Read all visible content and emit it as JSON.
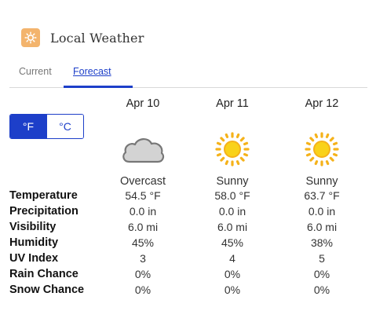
{
  "header": {
    "title": "Local Weather",
    "icon": "weather-app-icon",
    "icon_color": "#f3b46d"
  },
  "tabs": [
    {
      "label": "Current",
      "active": false
    },
    {
      "label": "Forecast",
      "active": true
    }
  ],
  "units": {
    "fahrenheit": "°F",
    "celsius": "°C",
    "selected": "°F"
  },
  "accent_color": "#1d3fc9",
  "rows": [
    "Temperature",
    "Precipitation",
    "Visibility",
    "Humidity",
    "UV Index",
    "Rain Chance",
    "Snow Chance"
  ],
  "days": [
    {
      "date": "Apr 10",
      "icon": "cloud-icon",
      "condition": "Overcast",
      "values": [
        "54.5 °F",
        "0.0 in",
        "6.0 mi",
        "45%",
        "3",
        "0%",
        "0%"
      ]
    },
    {
      "date": "Apr 11",
      "icon": "sun-icon",
      "condition": "Sunny",
      "values": [
        "58.0 °F",
        "0.0 in",
        "6.0 mi",
        "45%",
        "4",
        "0%",
        "0%"
      ]
    },
    {
      "date": "Apr 12",
      "icon": "sun-icon",
      "condition": "Sunny",
      "values": [
        "63.7 °F",
        "0.0 in",
        "6.0 mi",
        "38%",
        "5",
        "0%",
        "0%"
      ]
    }
  ]
}
